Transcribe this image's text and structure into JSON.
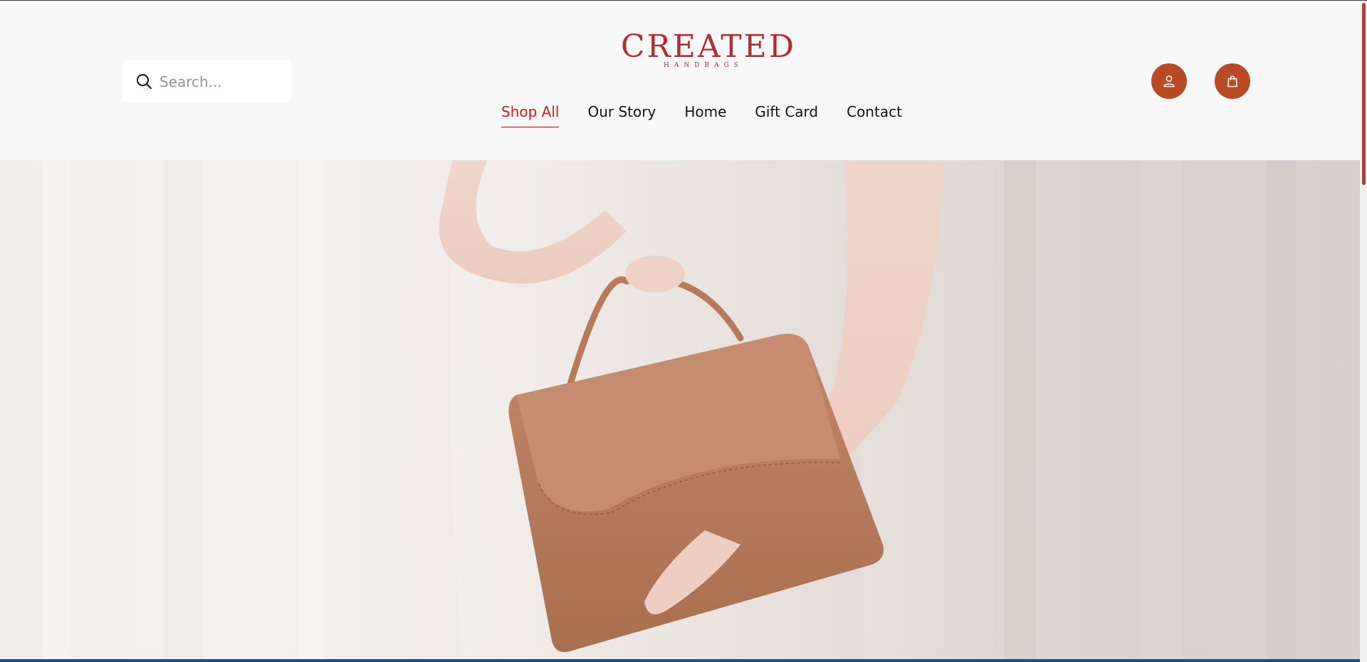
{
  "brand": {
    "name": "CREATED",
    "tagline": "HANDBAGS",
    "accent_color": "#b52b32",
    "button_color": "#b84a26"
  },
  "search": {
    "placeholder": "Search...",
    "icon": "search-icon"
  },
  "nav": {
    "items": [
      {
        "label": "Shop All",
        "active": true
      },
      {
        "label": "Our Story",
        "active": false
      },
      {
        "label": "Home",
        "active": false
      },
      {
        "label": "Gift Card",
        "active": false
      },
      {
        "label": "Contact",
        "active": false
      }
    ],
    "active_color": "#d0191d"
  },
  "actions": {
    "account_icon": "user-icon",
    "cart_icon": "shopping-bag-icon"
  },
  "hero": {
    "image": "woman-holding-brown-handbag"
  }
}
